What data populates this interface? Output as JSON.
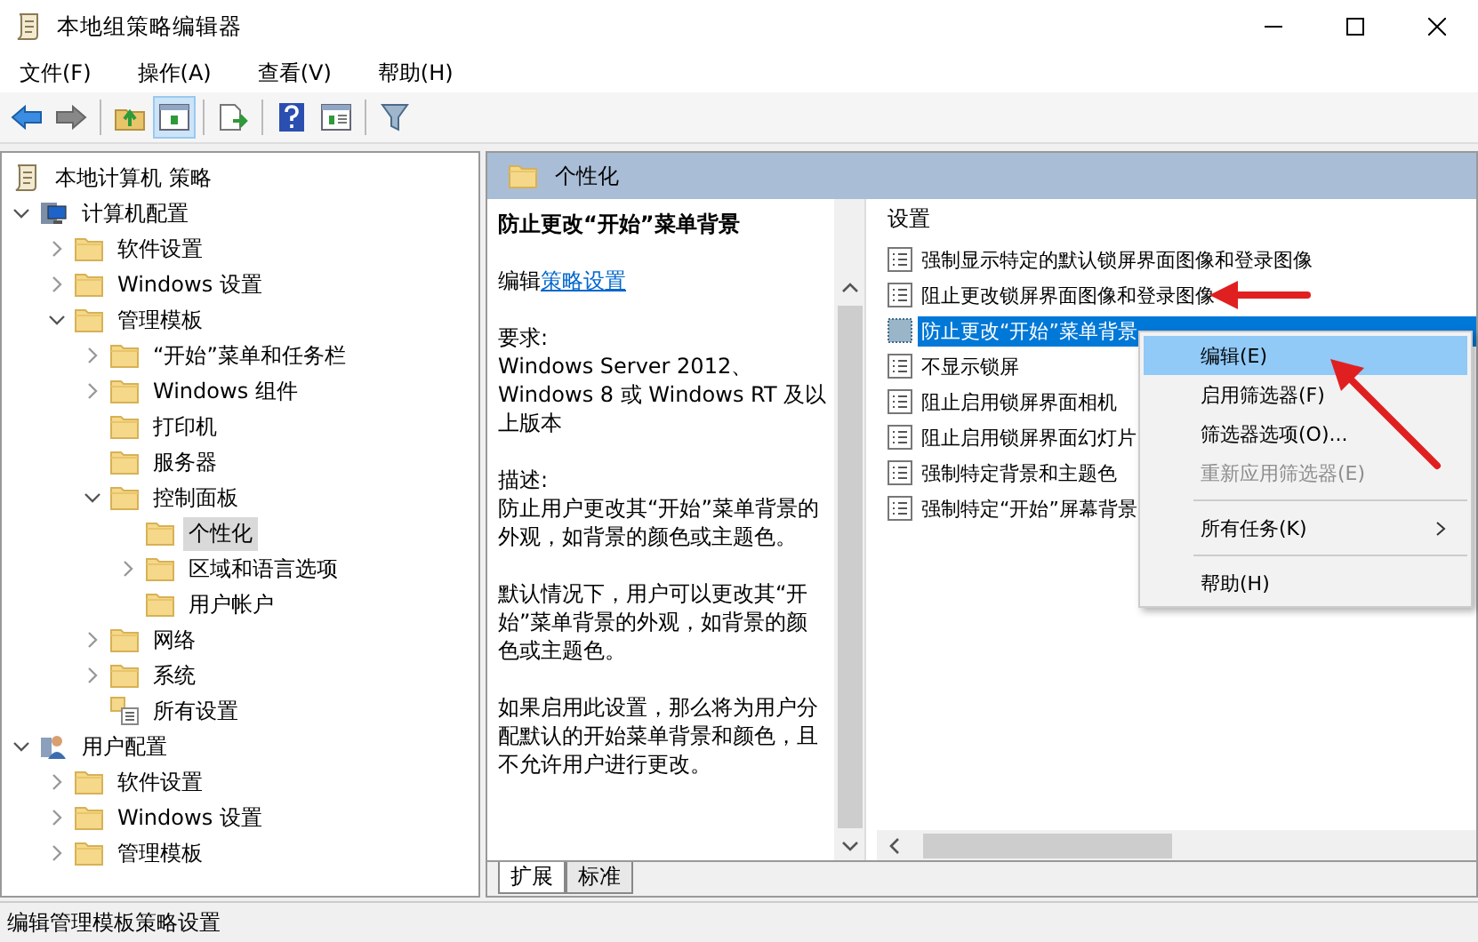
{
  "window": {
    "title": "本地组策略编辑器"
  },
  "menu": [
    "文件(F)",
    "操作(A)",
    "查看(V)",
    "帮助(H)"
  ],
  "toolbar": [
    {
      "kind": "back",
      "pressed": false
    },
    {
      "kind": "forward",
      "pressed": false
    },
    {
      "kind": "sep"
    },
    {
      "kind": "up",
      "pressed": false
    },
    {
      "kind": "tree",
      "pressed": true
    },
    {
      "kind": "sep"
    },
    {
      "kind": "export",
      "pressed": false
    },
    {
      "kind": "sep"
    },
    {
      "kind": "help",
      "pressed": false
    },
    {
      "kind": "props",
      "pressed": false
    },
    {
      "kind": "sep"
    },
    {
      "kind": "filter",
      "pressed": false
    }
  ],
  "tree": {
    "label": "本地计算机 策略",
    "children": [
      {
        "label": "计算机配置",
        "kind": "computer",
        "expanded": true,
        "selected": false,
        "children": [
          {
            "label": "软件设置",
            "kind": "folder",
            "expanded": false,
            "selected": false
          },
          {
            "label": "Windows 设置",
            "kind": "folder",
            "expanded": false,
            "selected": false
          },
          {
            "label": "管理模板",
            "kind": "folder",
            "expanded": true,
            "selected": false,
            "children": [
              {
                "label": "“开始”菜单和任务栏",
                "kind": "folder",
                "expanded": false,
                "selected": false
              },
              {
                "label": "Windows 组件",
                "kind": "folder",
                "expanded": false,
                "selected": false
              },
              {
                "label": "打印机",
                "kind": "folder",
                "selected": false
              },
              {
                "label": "服务器",
                "kind": "folder",
                "selected": false
              },
              {
                "label": "控制面板",
                "kind": "folder",
                "expanded": true,
                "selected": false,
                "children": [
                  {
                    "label": "个性化",
                    "kind": "folder",
                    "selected": true
                  },
                  {
                    "label": "区域和语言选项",
                    "kind": "folder",
                    "expanded": false,
                    "selected": false
                  },
                  {
                    "label": "用户帐户",
                    "kind": "folder",
                    "selected": false
                  }
                ]
              },
              {
                "label": "网络",
                "kind": "folder",
                "expanded": false,
                "selected": false
              },
              {
                "label": "系统",
                "kind": "folder",
                "expanded": false,
                "selected": false
              },
              {
                "label": "所有设置",
                "kind": "settings",
                "selected": false
              }
            ]
          }
        ]
      },
      {
        "label": "用户配置",
        "kind": "user",
        "expanded": true,
        "selected": false,
        "children": [
          {
            "label": "软件设置",
            "kind": "folder",
            "expanded": false,
            "selected": false
          },
          {
            "label": "Windows 设置",
            "kind": "folder",
            "expanded": false,
            "selected": false
          },
          {
            "label": "管理模板",
            "kind": "folder",
            "expanded": false,
            "selected": false
          }
        ]
      }
    ]
  },
  "panel": {
    "title": "个性化"
  },
  "description": {
    "title": "防止更改“开始”菜单背景",
    "edit_prefix": "编辑",
    "edit_link": "策略设置",
    "paragraphs": [
      [
        "要求:",
        "Windows Server 2012、Windows 8 或 Windows RT 及以上版本"
      ],
      [
        "描述:",
        "防止用户更改其“开始”菜单背景的外观，如背景的颜色或主题色。"
      ],
      [
        "默认情况下，用户可以更改其“开始”菜单背景的外观，如背景的颜色或主题色。"
      ],
      [
        "如果启用此设置，那么将为用户分配默认的开始菜单背景和颜色，且不允许用户进行更改。"
      ]
    ]
  },
  "settings": {
    "header": "设置",
    "items": [
      {
        "label": "强制显示特定的默认锁屏界面图像和登录图像",
        "selected": false
      },
      {
        "label": "阻止更改锁屏界面图像和登录图像",
        "selected": false
      },
      {
        "label": "防止更改“开始”菜单背景",
        "selected": true
      },
      {
        "label": "不显示锁屏",
        "selected": false
      },
      {
        "label": "阻止启用锁屏界面相机",
        "selected": false
      },
      {
        "label": "阻止启用锁屏界面幻灯片",
        "selected": false
      },
      {
        "label": "强制特定背景和主题色",
        "selected": false
      },
      {
        "label": "强制特定“开始”屏幕背景",
        "selected": false
      }
    ]
  },
  "context_menu": [
    {
      "kind": "item",
      "label": "编辑(E)",
      "selected": true,
      "disabled": false
    },
    {
      "kind": "item",
      "label": "启用筛选器(F)",
      "selected": false,
      "disabled": false
    },
    {
      "kind": "item",
      "label": "筛选器选项(O)...",
      "selected": false,
      "disabled": false
    },
    {
      "kind": "item",
      "label": "重新应用筛选器(E)",
      "selected": false,
      "disabled": true
    },
    {
      "kind": "separator"
    },
    {
      "kind": "submenu",
      "label": "所有任务(K)",
      "selected": false,
      "disabled": false
    },
    {
      "kind": "separator"
    },
    {
      "kind": "item",
      "label": "帮助(H)",
      "selected": false,
      "disabled": false
    }
  ],
  "tabs": [
    {
      "label": "扩展",
      "selected": true
    },
    {
      "label": "标准",
      "selected": false
    }
  ],
  "status_bar": "编辑管理模板策略设置"
}
